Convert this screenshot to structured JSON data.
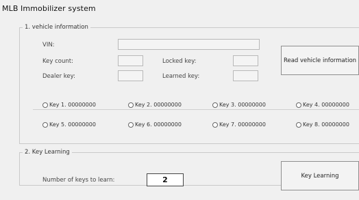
{
  "window_title": "MLB Immobilizer system",
  "vehicle_info": {
    "legend": "1. vehicle information",
    "vin_label": "VIN:",
    "key_count_label": "Key count:",
    "dealer_key_label": "Dealer key:",
    "locked_key_label": "Locked key:",
    "learned_key_label": "Learned key:",
    "read_button": "Read vehicle information"
  },
  "keys": [
    "Key 1. 00000000",
    "Key 2. 00000000",
    "Key 3. 00000000",
    "Key 4. 00000000",
    "Key 5. 00000000",
    "Key 6. 00000000",
    "Key 7. 00000000",
    "Key 8. 00000000"
  ],
  "key_learning": {
    "legend": "2. Key Learning",
    "count_label": "Number of keys to learn:",
    "count_value": "2",
    "button": "Key Learning"
  }
}
